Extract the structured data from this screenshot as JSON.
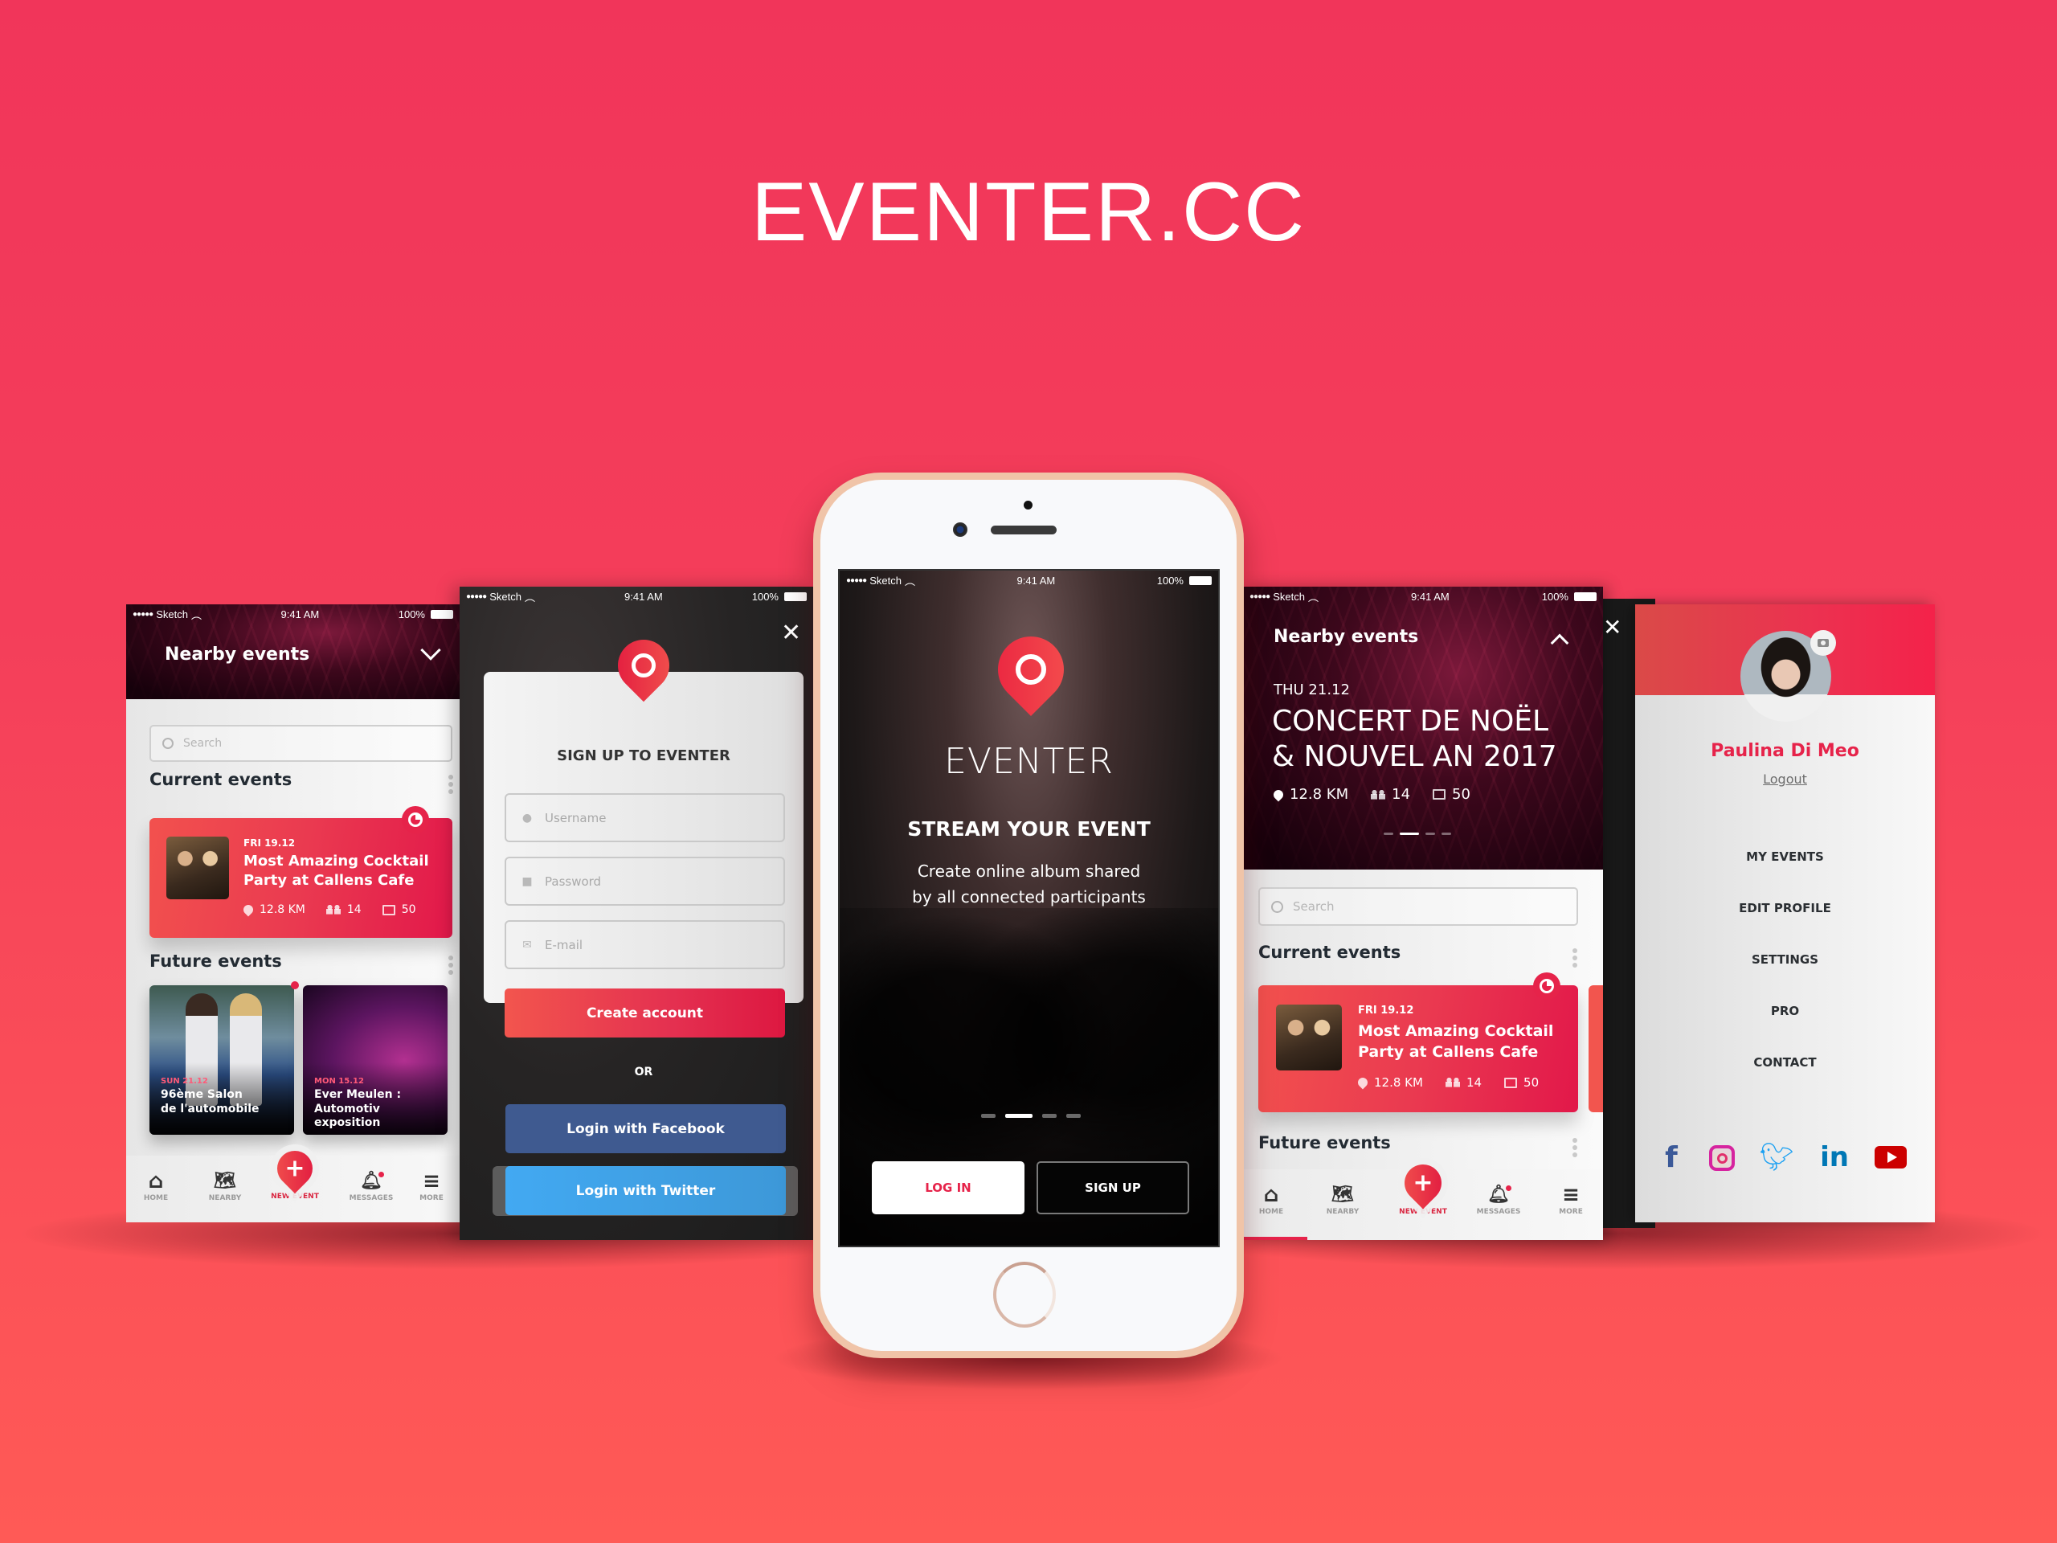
{
  "hero": {
    "title": "EVENTER.CC"
  },
  "colors": {
    "brand_red": "#E6234A",
    "bg_top": "#F1355A",
    "bg_bottom": "#FF5A56",
    "facebook": "#3B5998",
    "twitter": "#3FA9F5",
    "linkedin": "#0077B5",
    "youtube": "#CC0000"
  },
  "statusbar": {
    "carrier": "Sketch",
    "time": "9:41 AM",
    "battery": "100%"
  },
  "screen_home": {
    "header_title": "Nearby events",
    "search_placeholder": "Search",
    "current_events_title": "Current events",
    "current_event": {
      "date": "FRI 19.12",
      "title_line1": "Most Amazing Cocktail",
      "title_line2": "Party at Callens Cafe",
      "distance": "12.8 KM",
      "participants": "14",
      "photos": "50"
    },
    "future_events_title": "Future events",
    "future_events": [
      {
        "date": "SUN 21.12",
        "title_line1": "96ème Salon",
        "title_line2": "de l'automobile"
      },
      {
        "date": "MON 15.12",
        "title_line1": "Ever Meulen :",
        "title_line2": "Automotiv exposition"
      }
    ]
  },
  "tabbar": {
    "items": [
      {
        "label": "HOME",
        "icon": "home-icon"
      },
      {
        "label": "NEARBY",
        "icon": "map-icon"
      },
      {
        "label": "NEW EVENT",
        "icon": "plus-pin-icon",
        "active": true
      },
      {
        "label": "MESSAGES",
        "icon": "bell-icon"
      },
      {
        "label": "MORE",
        "icon": "menu-icon"
      }
    ]
  },
  "screen_signup": {
    "title": "SIGN UP TO EVENTER",
    "username_placeholder": "Username",
    "password_placeholder": "Password",
    "email_placeholder": "E-mail",
    "create_account_label": "Create account",
    "or_label": "OR",
    "facebook_label": "Login with Facebook",
    "twitter_label": "Login with Twitter"
  },
  "screen_splash": {
    "brand": "EVENTER",
    "headline": "STREAM YOUR EVENT",
    "subtitle_line1": "Create online album shared",
    "subtitle_line2": "by all connected participants",
    "pager_total": 4,
    "pager_active": 2,
    "login_label": "LOG IN",
    "signup_label": "SIGN UP"
  },
  "screen_nearby_expanded": {
    "header_title": "Nearby events",
    "featured": {
      "date": "THU 21.12",
      "title_line1": "CONCERT DE NOËL",
      "title_line2": "& NOUVEL AN 2017",
      "distance": "12.8 KM",
      "participants": "14",
      "photos": "50"
    },
    "pager_total": 4,
    "pager_active": 2,
    "search_placeholder": "Search",
    "current_events_title": "Current events",
    "current_event": {
      "date": "FRI 19.12",
      "title_line1": "Most Amazing Cocktail",
      "title_line2": "Party at Callens Cafe",
      "distance": "12.8 KM",
      "participants": "14",
      "photos": "50"
    },
    "future_events_title": "Future events"
  },
  "screen_profile": {
    "user_name": "Paulina Di Meo",
    "logout_label": "Logout",
    "menu": [
      "MY EVENTS",
      "EDIT PROFILE",
      "SETTINGS",
      "PRO",
      "CONTACT"
    ],
    "social": [
      "facebook",
      "instagram",
      "twitter",
      "linkedin",
      "youtube"
    ]
  }
}
